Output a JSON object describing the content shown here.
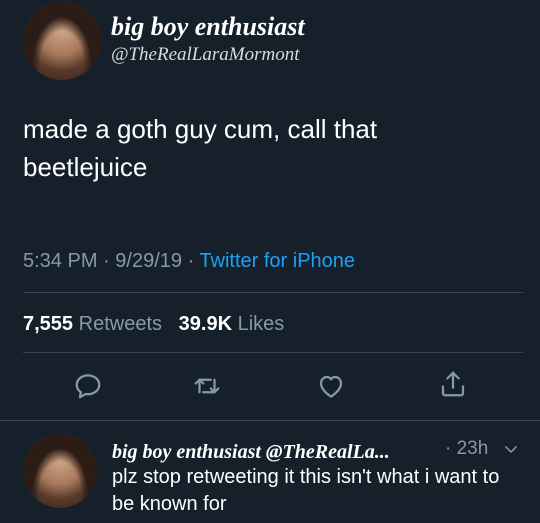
{
  "tweet": {
    "display_name": "big boy enthusiast",
    "handle": "@TheRealLaraMormont",
    "text": "made a goth guy cum, call that beetlejuice",
    "time": "5:34 PM",
    "date": "9/29/19",
    "source": "Twitter for iPhone",
    "retweets_count": "7,555",
    "retweets_label": "Retweets",
    "likes_count": "39.9K",
    "likes_label": "Likes"
  },
  "reply": {
    "display_name_and_handle": "big boy enthusiast @TheRealLa...",
    "time": "23h",
    "text": "plz stop retweeting it this isn't what i want to be known for"
  },
  "colors": {
    "background": "#15202b",
    "link": "#1da1f2",
    "muted": "#8899a6",
    "divider": "#38444d"
  },
  "icons": [
    "reply-icon",
    "retweet-icon",
    "like-icon",
    "share-icon",
    "chevron-down-icon"
  ]
}
